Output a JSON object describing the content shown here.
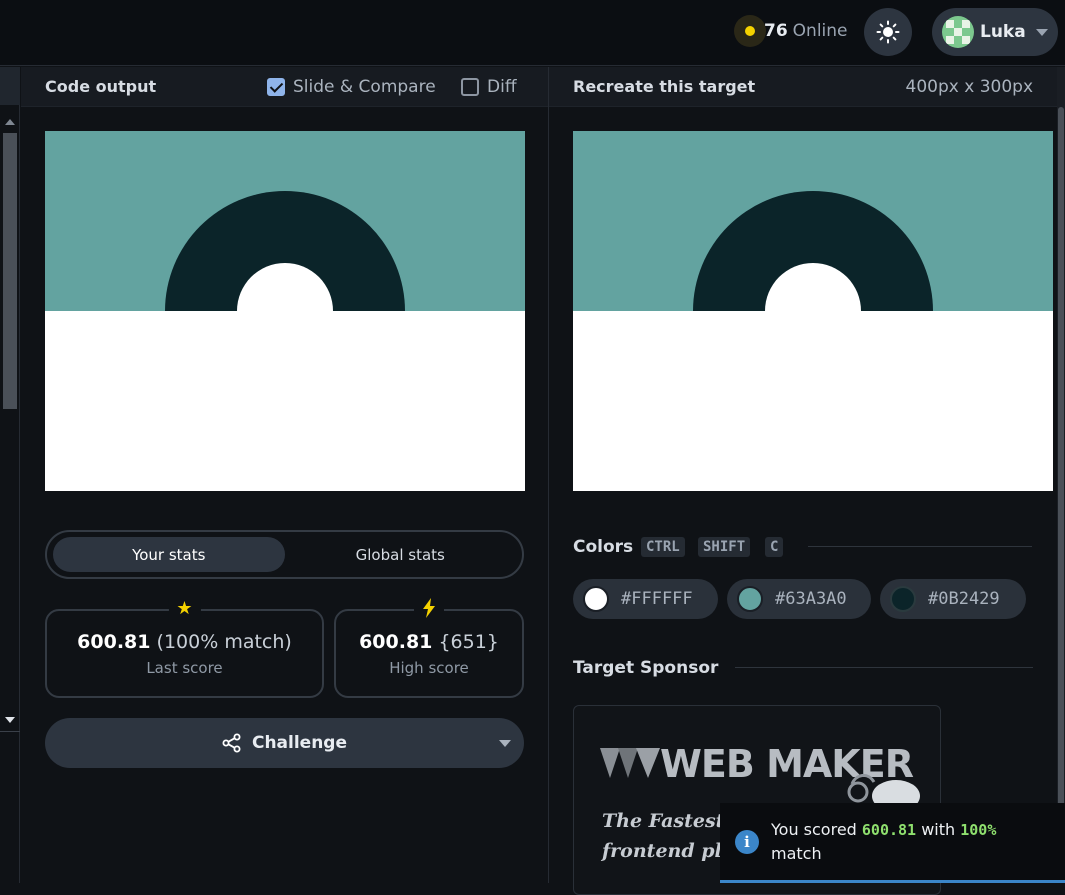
{
  "header": {
    "online_count": "76",
    "online_label": "Online",
    "user_name": "Luka"
  },
  "output_panel": {
    "title": "Code output",
    "slide_compare_label": "Slide & Compare",
    "slide_compare_checked": true,
    "diff_label": "Diff",
    "diff_checked": false
  },
  "target_panel": {
    "title": "Recreate this target",
    "dimensions": "400px x 300px"
  },
  "stats": {
    "tab_your": "Your stats",
    "tab_global": "Global stats",
    "last_score_value": "600.81",
    "last_score_match": "(100% match)",
    "last_score_label": "Last score",
    "high_score_value": "600.81",
    "high_score_extra": "{651}",
    "high_score_label": "High score",
    "challenge_label": "Challenge"
  },
  "colors": {
    "title": "Colors",
    "shortcut": [
      "CTRL",
      "SHIFT",
      "C"
    ],
    "swatches": [
      {
        "hex": "#FFFFFF",
        "color": "#ffffff"
      },
      {
        "hex": "#63A3A0",
        "color": "#63a3a0"
      },
      {
        "hex": "#0B2429",
        "color": "#0b2429"
      }
    ]
  },
  "sponsor": {
    "title": "Target Sponsor",
    "name": "WEB MAKER",
    "tagline_1": "The Fastest",
    "tagline_2": "frontend pl"
  },
  "toast": {
    "prefix": "You scored",
    "score": "600.81",
    "middle": "with",
    "match": "100%",
    "suffix": "match"
  },
  "target_colors": {
    "background": "#ffffff",
    "sky": "#63a3a0",
    "ring": "#0b2429"
  }
}
